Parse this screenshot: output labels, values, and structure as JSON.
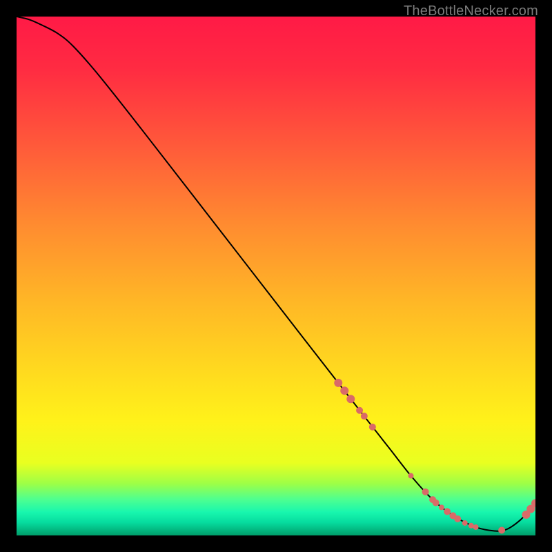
{
  "attribution": "TheBottleNecker.com",
  "chart_data": {
    "type": "line",
    "title": "",
    "xlabel": "",
    "ylabel": "",
    "xlim": [
      0,
      100
    ],
    "ylim": [
      0,
      100
    ],
    "gradient_stops": [
      {
        "offset": 0.0,
        "color": "#ff1a46"
      },
      {
        "offset": 0.1,
        "color": "#ff2b42"
      },
      {
        "offset": 0.25,
        "color": "#ff5a3a"
      },
      {
        "offset": 0.4,
        "color": "#ff8b30"
      },
      {
        "offset": 0.55,
        "color": "#ffb726"
      },
      {
        "offset": 0.68,
        "color": "#ffd91f"
      },
      {
        "offset": 0.78,
        "color": "#fff21a"
      },
      {
        "offset": 0.86,
        "color": "#e9ff20"
      },
      {
        "offset": 0.9,
        "color": "#9eff46"
      },
      {
        "offset": 0.93,
        "color": "#4fff8f"
      },
      {
        "offset": 0.955,
        "color": "#18f7ae"
      },
      {
        "offset": 0.975,
        "color": "#06dc9e"
      },
      {
        "offset": 1.0,
        "color": "#009e6a"
      }
    ],
    "series": [
      {
        "name": "bottleneck-curve",
        "x": [
          0.0,
          2.5,
          5.0,
          8.0,
          11.0,
          16.0,
          24.0,
          33.0,
          44.0,
          55.0,
          62.0,
          68.0,
          72.0,
          76.0,
          80.0,
          84.0,
          88.0,
          91.0,
          94.0,
          97.0,
          100.0
        ],
        "y": [
          100.0,
          99.4,
          98.3,
          96.7,
          94.2,
          88.5,
          78.4,
          66.8,
          52.6,
          38.4,
          29.4,
          21.7,
          16.6,
          11.5,
          7.1,
          3.9,
          1.8,
          1.0,
          1.0,
          2.9,
          6.2
        ]
      }
    ],
    "markers": {
      "name": "highlight-points",
      "color": "#d96a68",
      "points": [
        {
          "x": 62.0,
          "y": 29.4,
          "r": 6
        },
        {
          "x": 63.2,
          "y": 27.9,
          "r": 6
        },
        {
          "x": 64.4,
          "y": 26.3,
          "r": 6
        },
        {
          "x": 66.1,
          "y": 24.1,
          "r": 5
        },
        {
          "x": 67.0,
          "y": 23.0,
          "r": 5
        },
        {
          "x": 68.6,
          "y": 20.9,
          "r": 5
        },
        {
          "x": 76.0,
          "y": 11.5,
          "r": 4
        },
        {
          "x": 78.8,
          "y": 8.4,
          "r": 5
        },
        {
          "x": 80.2,
          "y": 6.9,
          "r": 5
        },
        {
          "x": 80.8,
          "y": 6.3,
          "r": 5
        },
        {
          "x": 81.9,
          "y": 5.4,
          "r": 4
        },
        {
          "x": 83.0,
          "y": 4.6,
          "r": 5
        },
        {
          "x": 84.1,
          "y": 3.8,
          "r": 5
        },
        {
          "x": 85.0,
          "y": 3.2,
          "r": 5
        },
        {
          "x": 86.4,
          "y": 2.4,
          "r": 4
        },
        {
          "x": 87.6,
          "y": 1.9,
          "r": 4
        },
        {
          "x": 88.5,
          "y": 1.6,
          "r": 4
        },
        {
          "x": 93.5,
          "y": 1.0,
          "r": 5
        },
        {
          "x": 98.2,
          "y": 4.0,
          "r": 6
        },
        {
          "x": 99.1,
          "y": 5.1,
          "r": 6
        },
        {
          "x": 100.0,
          "y": 6.2,
          "r": 6
        }
      ]
    }
  }
}
